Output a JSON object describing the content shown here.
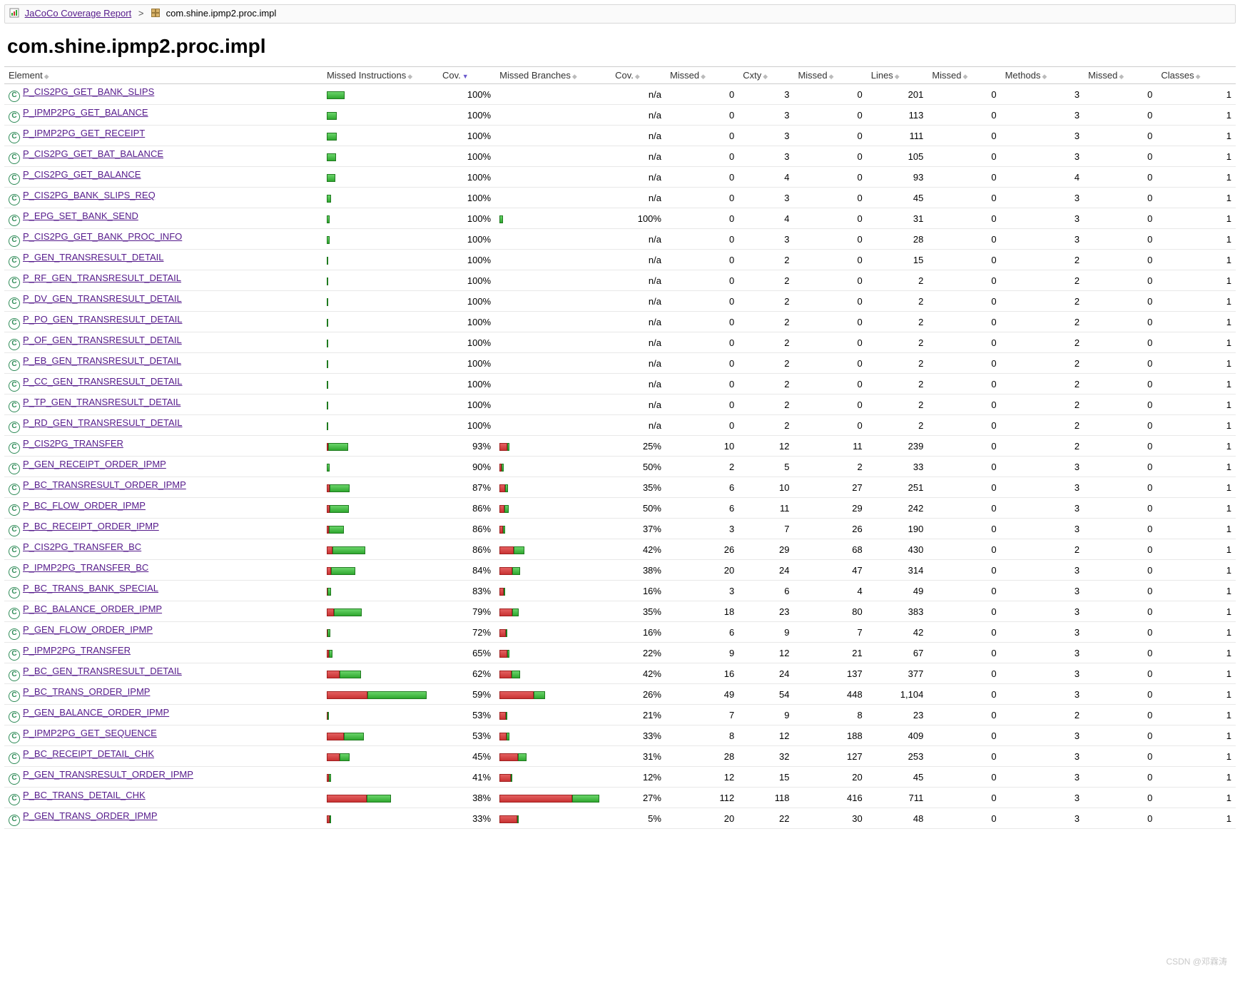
{
  "breadcrumb": {
    "report_label": "JaCoCo Coverage Report",
    "sep": ">",
    "pkg_label": "com.shine.ipmp2.proc.impl"
  },
  "title": "com.shine.ipmp2.proc.impl",
  "columns": {
    "element": "Element",
    "missed_instr": "Missed Instructions",
    "cov1": "Cov.",
    "missed_br": "Missed Branches",
    "cov2": "Cov.",
    "missed1": "Missed",
    "cxty": "Cxty",
    "missed2": "Missed",
    "lines": "Lines",
    "missed3": "Missed",
    "methods": "Methods",
    "missed4": "Missed",
    "classes": "Classes"
  },
  "chart_data": {
    "type": "table",
    "title": "JaCoCo Coverage — com.shine.ipmp2.proc.impl",
    "instr_bar_max": 1104,
    "branch_bar_max": 118,
    "rows": [
      {
        "name": "P_CIS2PG_GET_BANK_SLIPS",
        "instr_bar": 201,
        "instr_cov": "100%",
        "instr_red_pct": 0,
        "branch_bar": 0,
        "branch_cov": "n/a",
        "branch_red_pct": 0,
        "missed_cxty": 0,
        "cxty": 3,
        "missed_lines": 0,
        "lines": 201,
        "missed_methods": 0,
        "methods": 3,
        "missed_classes": 0,
        "classes": 1
      },
      {
        "name": "P_IPMP2PG_GET_BALANCE",
        "instr_bar": 113,
        "instr_cov": "100%",
        "instr_red_pct": 0,
        "branch_bar": 0,
        "branch_cov": "n/a",
        "branch_red_pct": 0,
        "missed_cxty": 0,
        "cxty": 3,
        "missed_lines": 0,
        "lines": 113,
        "missed_methods": 0,
        "methods": 3,
        "missed_classes": 0,
        "classes": 1
      },
      {
        "name": "P_IPMP2PG_GET_RECEIPT",
        "instr_bar": 111,
        "instr_cov": "100%",
        "instr_red_pct": 0,
        "branch_bar": 0,
        "branch_cov": "n/a",
        "branch_red_pct": 0,
        "missed_cxty": 0,
        "cxty": 3,
        "missed_lines": 0,
        "lines": 111,
        "missed_methods": 0,
        "methods": 3,
        "missed_classes": 0,
        "classes": 1
      },
      {
        "name": "P_CIS2PG_GET_BAT_BALANCE",
        "instr_bar": 105,
        "instr_cov": "100%",
        "instr_red_pct": 0,
        "branch_bar": 0,
        "branch_cov": "n/a",
        "branch_red_pct": 0,
        "missed_cxty": 0,
        "cxty": 3,
        "missed_lines": 0,
        "lines": 105,
        "missed_methods": 0,
        "methods": 3,
        "missed_classes": 0,
        "classes": 1
      },
      {
        "name": "P_CIS2PG_GET_BALANCE",
        "instr_bar": 93,
        "instr_cov": "100%",
        "instr_red_pct": 0,
        "branch_bar": 0,
        "branch_cov": "n/a",
        "branch_red_pct": 0,
        "missed_cxty": 0,
        "cxty": 4,
        "missed_lines": 0,
        "lines": 93,
        "missed_methods": 0,
        "methods": 4,
        "missed_classes": 0,
        "classes": 1
      },
      {
        "name": "P_CIS2PG_BANK_SLIPS_REQ",
        "instr_bar": 45,
        "instr_cov": "100%",
        "instr_red_pct": 0,
        "branch_bar": 0,
        "branch_cov": "n/a",
        "branch_red_pct": 0,
        "missed_cxty": 0,
        "cxty": 3,
        "missed_lines": 0,
        "lines": 45,
        "missed_methods": 0,
        "methods": 3,
        "missed_classes": 0,
        "classes": 1
      },
      {
        "name": "P_EPG_SET_BANK_SEND",
        "instr_bar": 31,
        "instr_cov": "100%",
        "instr_red_pct": 0,
        "branch_bar": 4,
        "branch_cov": "100%",
        "branch_red_pct": 0,
        "missed_cxty": 0,
        "cxty": 4,
        "missed_lines": 0,
        "lines": 31,
        "missed_methods": 0,
        "methods": 3,
        "missed_classes": 0,
        "classes": 1
      },
      {
        "name": "P_CIS2PG_GET_BANK_PROC_INFO",
        "instr_bar": 28,
        "instr_cov": "100%",
        "instr_red_pct": 0,
        "branch_bar": 0,
        "branch_cov": "n/a",
        "branch_red_pct": 0,
        "missed_cxty": 0,
        "cxty": 3,
        "missed_lines": 0,
        "lines": 28,
        "missed_methods": 0,
        "methods": 3,
        "missed_classes": 0,
        "classes": 1
      },
      {
        "name": "P_GEN_TRANSRESULT_DETAIL",
        "instr_bar": 15,
        "instr_cov": "100%",
        "instr_red_pct": 0,
        "branch_bar": 0,
        "branch_cov": "n/a",
        "branch_red_pct": 0,
        "missed_cxty": 0,
        "cxty": 2,
        "missed_lines": 0,
        "lines": 15,
        "missed_methods": 0,
        "methods": 2,
        "missed_classes": 0,
        "classes": 1
      },
      {
        "name": "P_RF_GEN_TRANSRESULT_DETAIL",
        "instr_bar": 2,
        "instr_cov": "100%",
        "instr_red_pct": 0,
        "branch_bar": 0,
        "branch_cov": "n/a",
        "branch_red_pct": 0,
        "missed_cxty": 0,
        "cxty": 2,
        "missed_lines": 0,
        "lines": 2,
        "missed_methods": 0,
        "methods": 2,
        "missed_classes": 0,
        "classes": 1
      },
      {
        "name": "P_DV_GEN_TRANSRESULT_DETAIL",
        "instr_bar": 2,
        "instr_cov": "100%",
        "instr_red_pct": 0,
        "branch_bar": 0,
        "branch_cov": "n/a",
        "branch_red_pct": 0,
        "missed_cxty": 0,
        "cxty": 2,
        "missed_lines": 0,
        "lines": 2,
        "missed_methods": 0,
        "methods": 2,
        "missed_classes": 0,
        "classes": 1
      },
      {
        "name": "P_PO_GEN_TRANSRESULT_DETAIL",
        "instr_bar": 2,
        "instr_cov": "100%",
        "instr_red_pct": 0,
        "branch_bar": 0,
        "branch_cov": "n/a",
        "branch_red_pct": 0,
        "missed_cxty": 0,
        "cxty": 2,
        "missed_lines": 0,
        "lines": 2,
        "missed_methods": 0,
        "methods": 2,
        "missed_classes": 0,
        "classes": 1
      },
      {
        "name": "P_OF_GEN_TRANSRESULT_DETAIL",
        "instr_bar": 2,
        "instr_cov": "100%",
        "instr_red_pct": 0,
        "branch_bar": 0,
        "branch_cov": "n/a",
        "branch_red_pct": 0,
        "missed_cxty": 0,
        "cxty": 2,
        "missed_lines": 0,
        "lines": 2,
        "missed_methods": 0,
        "methods": 2,
        "missed_classes": 0,
        "classes": 1
      },
      {
        "name": "P_EB_GEN_TRANSRESULT_DETAIL",
        "instr_bar": 2,
        "instr_cov": "100%",
        "instr_red_pct": 0,
        "branch_bar": 0,
        "branch_cov": "n/a",
        "branch_red_pct": 0,
        "missed_cxty": 0,
        "cxty": 2,
        "missed_lines": 0,
        "lines": 2,
        "missed_methods": 0,
        "methods": 2,
        "missed_classes": 0,
        "classes": 1
      },
      {
        "name": "P_CC_GEN_TRANSRESULT_DETAIL",
        "instr_bar": 2,
        "instr_cov": "100%",
        "instr_red_pct": 0,
        "branch_bar": 0,
        "branch_cov": "n/a",
        "branch_red_pct": 0,
        "missed_cxty": 0,
        "cxty": 2,
        "missed_lines": 0,
        "lines": 2,
        "missed_methods": 0,
        "methods": 2,
        "missed_classes": 0,
        "classes": 1
      },
      {
        "name": "P_TP_GEN_TRANSRESULT_DETAIL",
        "instr_bar": 2,
        "instr_cov": "100%",
        "instr_red_pct": 0,
        "branch_bar": 0,
        "branch_cov": "n/a",
        "branch_red_pct": 0,
        "missed_cxty": 0,
        "cxty": 2,
        "missed_lines": 0,
        "lines": 2,
        "missed_methods": 0,
        "methods": 2,
        "missed_classes": 0,
        "classes": 1
      },
      {
        "name": "P_RD_GEN_TRANSRESULT_DETAIL",
        "instr_bar": 2,
        "instr_cov": "100%",
        "instr_red_pct": 0,
        "branch_bar": 0,
        "branch_cov": "n/a",
        "branch_red_pct": 0,
        "missed_cxty": 0,
        "cxty": 2,
        "missed_lines": 0,
        "lines": 2,
        "missed_methods": 0,
        "methods": 2,
        "missed_classes": 0,
        "classes": 1
      },
      {
        "name": "P_CIS2PG_TRANSFER",
        "instr_bar": 239,
        "instr_cov": "93%",
        "instr_red_pct": 7,
        "branch_bar": 12,
        "branch_cov": "25%",
        "branch_red_pct": 75,
        "missed_cxty": 10,
        "cxty": 12,
        "missed_lines": 11,
        "lines": 239,
        "missed_methods": 0,
        "methods": 2,
        "missed_classes": 0,
        "classes": 1
      },
      {
        "name": "P_GEN_RECEIPT_ORDER_IPMP",
        "instr_bar": 33,
        "instr_cov": "90%",
        "instr_red_pct": 10,
        "branch_bar": 5,
        "branch_cov": "50%",
        "branch_red_pct": 50,
        "missed_cxty": 2,
        "cxty": 5,
        "missed_lines": 2,
        "lines": 33,
        "missed_methods": 0,
        "methods": 3,
        "missed_classes": 0,
        "classes": 1
      },
      {
        "name": "P_BC_TRANSRESULT_ORDER_IPMP",
        "instr_bar": 251,
        "instr_cov": "87%",
        "instr_red_pct": 13,
        "branch_bar": 10,
        "branch_cov": "35%",
        "branch_red_pct": 65,
        "missed_cxty": 6,
        "cxty": 10,
        "missed_lines": 27,
        "lines": 251,
        "missed_methods": 0,
        "methods": 3,
        "missed_classes": 0,
        "classes": 1
      },
      {
        "name": "P_BC_FLOW_ORDER_IPMP",
        "instr_bar": 242,
        "instr_cov": "86%",
        "instr_red_pct": 14,
        "branch_bar": 11,
        "branch_cov": "50%",
        "branch_red_pct": 50,
        "missed_cxty": 6,
        "cxty": 11,
        "missed_lines": 29,
        "lines": 242,
        "missed_methods": 0,
        "methods": 3,
        "missed_classes": 0,
        "classes": 1
      },
      {
        "name": "P_BC_RECEIPT_ORDER_IPMP",
        "instr_bar": 190,
        "instr_cov": "86%",
        "instr_red_pct": 14,
        "branch_bar": 7,
        "branch_cov": "37%",
        "branch_red_pct": 63,
        "missed_cxty": 3,
        "cxty": 7,
        "missed_lines": 26,
        "lines": 190,
        "missed_methods": 0,
        "methods": 3,
        "missed_classes": 0,
        "classes": 1
      },
      {
        "name": "P_CIS2PG_TRANSFER_BC",
        "instr_bar": 430,
        "instr_cov": "86%",
        "instr_red_pct": 14,
        "branch_bar": 29,
        "branch_cov": "42%",
        "branch_red_pct": 58,
        "missed_cxty": 26,
        "cxty": 29,
        "missed_lines": 68,
        "lines": 430,
        "missed_methods": 0,
        "methods": 2,
        "missed_classes": 0,
        "classes": 1
      },
      {
        "name": "P_IPMP2PG_TRANSFER_BC",
        "instr_bar": 314,
        "instr_cov": "84%",
        "instr_red_pct": 16,
        "branch_bar": 24,
        "branch_cov": "38%",
        "branch_red_pct": 62,
        "missed_cxty": 20,
        "cxty": 24,
        "missed_lines": 47,
        "lines": 314,
        "missed_methods": 0,
        "methods": 3,
        "missed_classes": 0,
        "classes": 1
      },
      {
        "name": "P_BC_TRANS_BANK_SPECIAL",
        "instr_bar": 49,
        "instr_cov": "83%",
        "instr_red_pct": 17,
        "branch_bar": 6,
        "branch_cov": "16%",
        "branch_red_pct": 84,
        "missed_cxty": 3,
        "cxty": 6,
        "missed_lines": 4,
        "lines": 49,
        "missed_methods": 0,
        "methods": 3,
        "missed_classes": 0,
        "classes": 1
      },
      {
        "name": "P_BC_BALANCE_ORDER_IPMP",
        "instr_bar": 383,
        "instr_cov": "79%",
        "instr_red_pct": 21,
        "branch_bar": 23,
        "branch_cov": "35%",
        "branch_red_pct": 65,
        "missed_cxty": 18,
        "cxty": 23,
        "missed_lines": 80,
        "lines": 383,
        "missed_methods": 0,
        "methods": 3,
        "missed_classes": 0,
        "classes": 1
      },
      {
        "name": "P_GEN_FLOW_ORDER_IPMP",
        "instr_bar": 42,
        "instr_cov": "72%",
        "instr_red_pct": 28,
        "branch_bar": 9,
        "branch_cov": "16%",
        "branch_red_pct": 84,
        "missed_cxty": 6,
        "cxty": 9,
        "missed_lines": 7,
        "lines": 42,
        "missed_methods": 0,
        "methods": 3,
        "missed_classes": 0,
        "classes": 1
      },
      {
        "name": "P_IPMP2PG_TRANSFER",
        "instr_bar": 67,
        "instr_cov": "65%",
        "instr_red_pct": 35,
        "branch_bar": 12,
        "branch_cov": "22%",
        "branch_red_pct": 78,
        "missed_cxty": 9,
        "cxty": 12,
        "missed_lines": 21,
        "lines": 67,
        "missed_methods": 0,
        "methods": 3,
        "missed_classes": 0,
        "classes": 1
      },
      {
        "name": "P_BC_GEN_TRANSRESULT_DETAIL",
        "instr_bar": 377,
        "instr_cov": "62%",
        "instr_red_pct": 38,
        "branch_bar": 24,
        "branch_cov": "42%",
        "branch_red_pct": 58,
        "missed_cxty": 16,
        "cxty": 24,
        "missed_lines": 137,
        "lines": 377,
        "missed_methods": 0,
        "methods": 3,
        "missed_classes": 0,
        "classes": 1
      },
      {
        "name": "P_BC_TRANS_ORDER_IPMP",
        "instr_bar": 1104,
        "instr_cov": "59%",
        "instr_red_pct": 41,
        "branch_bar": 54,
        "branch_cov": "26%",
        "branch_red_pct": 74,
        "missed_cxty": 49,
        "cxty": 54,
        "missed_lines": 448,
        "lines": "1,104",
        "missed_methods": 0,
        "methods": 3,
        "missed_classes": 0,
        "classes": 1
      },
      {
        "name": "P_GEN_BALANCE_ORDER_IPMP",
        "instr_bar": 23,
        "instr_cov": "53%",
        "instr_red_pct": 47,
        "branch_bar": 9,
        "branch_cov": "21%",
        "branch_red_pct": 79,
        "missed_cxty": 7,
        "cxty": 9,
        "missed_lines": 8,
        "lines": 23,
        "missed_methods": 0,
        "methods": 2,
        "missed_classes": 0,
        "classes": 1
      },
      {
        "name": "P_IPMP2PG_GET_SEQUENCE",
        "instr_bar": 409,
        "instr_cov": "53%",
        "instr_red_pct": 47,
        "branch_bar": 12,
        "branch_cov": "33%",
        "branch_red_pct": 67,
        "missed_cxty": 8,
        "cxty": 12,
        "missed_lines": 188,
        "lines": 409,
        "missed_methods": 0,
        "methods": 3,
        "missed_classes": 0,
        "classes": 1
      },
      {
        "name": "P_BC_RECEIPT_DETAIL_CHK",
        "instr_bar": 253,
        "instr_cov": "45%",
        "instr_red_pct": 55,
        "branch_bar": 32,
        "branch_cov": "31%",
        "branch_red_pct": 69,
        "missed_cxty": 28,
        "cxty": 32,
        "missed_lines": 127,
        "lines": 253,
        "missed_methods": 0,
        "methods": 3,
        "missed_classes": 0,
        "classes": 1
      },
      {
        "name": "P_GEN_TRANSRESULT_ORDER_IPMP",
        "instr_bar": 45,
        "instr_cov": "41%",
        "instr_red_pct": 59,
        "branch_bar": 15,
        "branch_cov": "12%",
        "branch_red_pct": 88,
        "missed_cxty": 12,
        "cxty": 15,
        "missed_lines": 20,
        "lines": 45,
        "missed_methods": 0,
        "methods": 3,
        "missed_classes": 0,
        "classes": 1
      },
      {
        "name": "P_BC_TRANS_DETAIL_CHK",
        "instr_bar": 711,
        "instr_cov": "38%",
        "instr_red_pct": 62,
        "branch_bar": 118,
        "branch_cov": "27%",
        "branch_red_pct": 73,
        "missed_cxty": 112,
        "cxty": 118,
        "missed_lines": 416,
        "lines": 711,
        "missed_methods": 0,
        "methods": 3,
        "missed_classes": 0,
        "classes": 1
      },
      {
        "name": "P_GEN_TRANS_ORDER_IPMP",
        "instr_bar": 48,
        "instr_cov": "33%",
        "instr_red_pct": 67,
        "branch_bar": 22,
        "branch_cov": "5%",
        "branch_red_pct": 95,
        "missed_cxty": 20,
        "cxty": 22,
        "missed_lines": 30,
        "lines": 48,
        "missed_methods": 0,
        "methods": 3,
        "missed_classes": 0,
        "classes": 1
      }
    ]
  },
  "watermark": "CSDN @邓霖涛"
}
